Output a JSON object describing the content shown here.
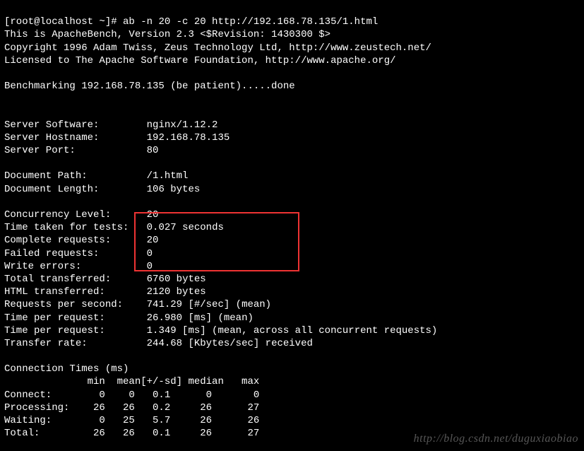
{
  "prompt": "[root@localhost ~]# ",
  "command": "ab -n 20 -c 20 http://192.168.78.135/1.html",
  "intro1": "This is ApacheBench, Version 2.3 <$Revision: 1430300 $>",
  "intro2": "Copyright 1996 Adam Twiss, Zeus Technology Ltd, http://www.zeustech.net/",
  "intro3": "Licensed to The Apache Software Foundation, http://www.apache.org/",
  "benchmark": "Benchmarking 192.168.78.135 (be patient).....done",
  "labels": {
    "server_software": "Server Software:",
    "server_hostname": "Server Hostname:",
    "server_port": "Server Port:",
    "doc_path": "Document Path:",
    "doc_length": "Document Length:",
    "concurrency": "Concurrency Level:",
    "time_taken": "Time taken for tests:",
    "complete": "Complete requests:",
    "failed": "Failed requests:",
    "write_errors": "Write errors:",
    "total_transferred": "Total transferred:",
    "html_transferred": "HTML transferred:",
    "rps": "Requests per second:",
    "tpr1": "Time per request:",
    "tpr2": "Time per request:",
    "transfer_rate": "Transfer rate:"
  },
  "values": {
    "server_software": "nginx/1.12.2",
    "server_hostname": "192.168.78.135",
    "server_port": "80",
    "doc_path": "/1.html",
    "doc_length": "106 bytes",
    "concurrency": "20",
    "time_taken": "0.027 seconds",
    "complete": "20",
    "failed": "0",
    "write_errors": "0",
    "total_transferred": "6760 bytes",
    "html_transferred": "2120 bytes",
    "rps": "741.29 [#/sec] (mean)",
    "tpr1": "26.980 [ms] (mean)",
    "tpr2": "1.349 [ms] (mean, across all concurrent requests)",
    "transfer_rate": "244.68 [Kbytes/sec] received"
  },
  "conn_header": "Connection Times (ms)",
  "conn_cols": "              min  mean[+/-sd] median   max",
  "conn_rows": {
    "connect": "Connect:        0    0   0.1      0       0",
    "processing": "Processing:    26   26   0.2     26      27",
    "waiting": "Waiting:        0   25   5.7     26      26",
    "total": "Total:         26   26   0.1     26      27"
  },
  "watermark": "http://blog.csdn.net/duguxiaobiao",
  "chart_data": {
    "type": "table",
    "title": "Connection Times (ms)",
    "columns": [
      "",
      "min",
      "mean",
      "+/-sd",
      "median",
      "max"
    ],
    "rows": [
      {
        "name": "Connect",
        "min": 0,
        "mean": 0,
        "sd": 0.1,
        "median": 0,
        "max": 0
      },
      {
        "name": "Processing",
        "min": 26,
        "mean": 26,
        "sd": 0.2,
        "median": 26,
        "max": 27
      },
      {
        "name": "Waiting",
        "min": 0,
        "mean": 25,
        "sd": 5.7,
        "median": 26,
        "max": 26
      },
      {
        "name": "Total",
        "min": 26,
        "mean": 26,
        "sd": 0.1,
        "median": 26,
        "max": 27
      }
    ]
  }
}
